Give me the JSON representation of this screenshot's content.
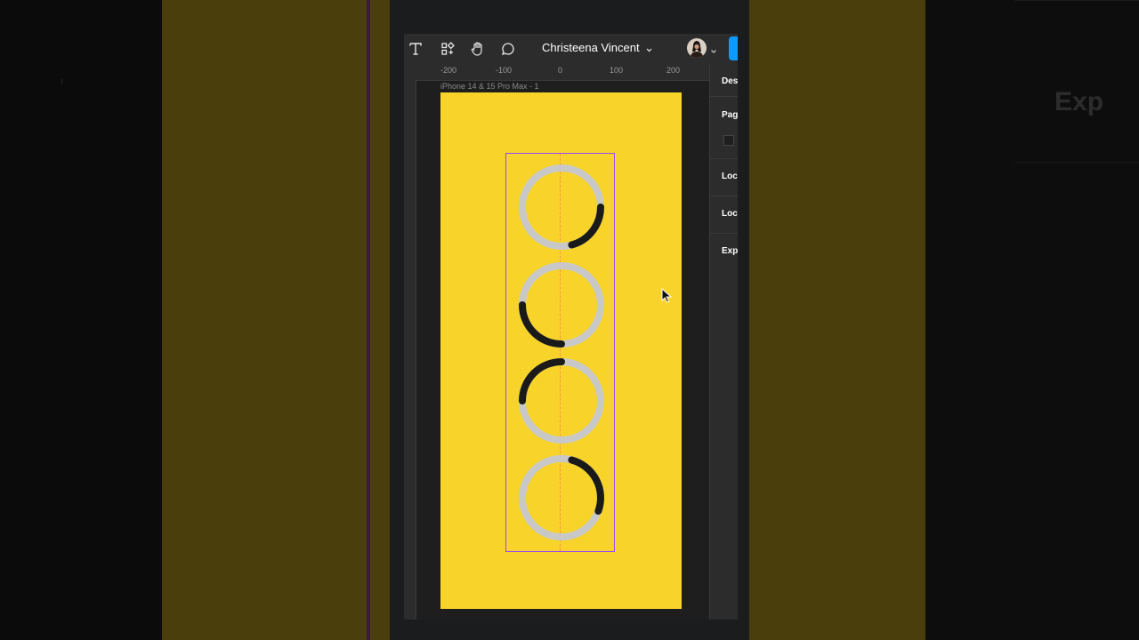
{
  "app": {
    "file_title": "Christeena Vincent",
    "frame_name": "iPhone 14 & 15 Pro Max - 1"
  },
  "toolbar": {
    "tools": [
      "text-tool",
      "resources-tool",
      "hand-tool",
      "comment-tool"
    ]
  },
  "rulers": {
    "horizontal": [
      "-200",
      "-100",
      "0",
      "100",
      "200"
    ]
  },
  "right_panel": {
    "items": [
      "Des",
      "Pag",
      "Loc",
      "Loc",
      "Exp"
    ]
  },
  "background": {
    "ghost_text": "Exp"
  },
  "loaders": [
    {
      "name": "loader-1",
      "arc_start_deg": 90,
      "arc_end_deg": 165
    },
    {
      "name": "loader-2",
      "arc_start_deg": 180,
      "arc_end_deg": 270
    },
    {
      "name": "loader-3",
      "arc_start_deg": 270,
      "arc_end_deg": 360
    },
    {
      "name": "loader-4",
      "arc_start_deg": 15,
      "arc_end_deg": 110
    }
  ],
  "colors": {
    "frame_fill": "#f8d42a",
    "selection": "#9747ff",
    "track": "#c8c8c8",
    "arc": "#1a1a1a",
    "share_button": "#0d99ff"
  }
}
